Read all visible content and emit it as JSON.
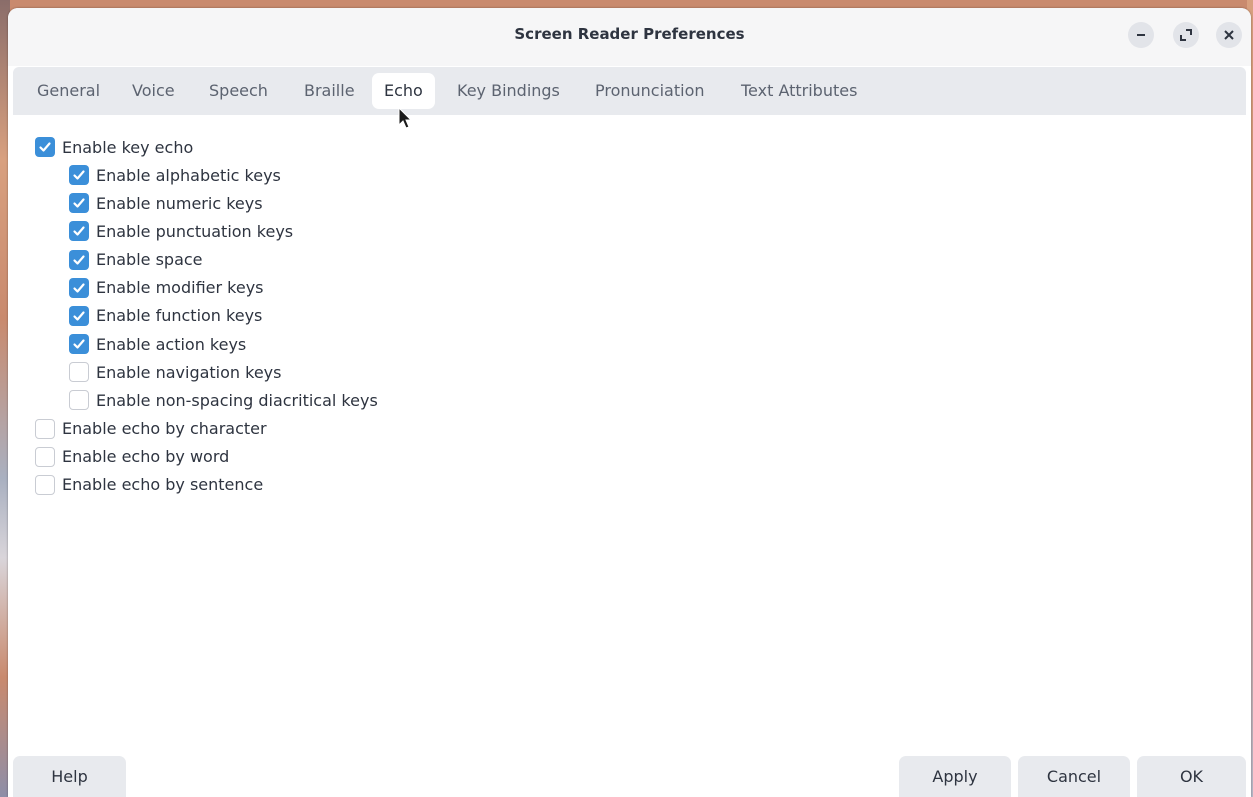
{
  "window": {
    "title": "Screen Reader Preferences"
  },
  "title_buttons": {
    "minimize": "minimize-icon",
    "maximize": "maximize-icon",
    "close": "close-icon"
  },
  "tabs": [
    {
      "label": "General"
    },
    {
      "label": "Voice"
    },
    {
      "label": "Speech"
    },
    {
      "label": "Braille"
    },
    {
      "label": "Echo",
      "active": true
    },
    {
      "label": "Key Bindings"
    },
    {
      "label": "Pronunciation"
    },
    {
      "label": "Text Attributes"
    }
  ],
  "options": [
    {
      "label": "Enable key echo",
      "checked": true,
      "indent": 0
    },
    {
      "label": "Enable alphabetic keys",
      "checked": true,
      "indent": 1
    },
    {
      "label": "Enable numeric keys",
      "checked": true,
      "indent": 1
    },
    {
      "label": "Enable punctuation keys",
      "checked": true,
      "indent": 1
    },
    {
      "label": "Enable space",
      "checked": true,
      "indent": 1
    },
    {
      "label": "Enable modifier keys",
      "checked": true,
      "indent": 1
    },
    {
      "label": "Enable function keys",
      "checked": true,
      "indent": 1
    },
    {
      "label": "Enable action keys",
      "checked": true,
      "indent": 1
    },
    {
      "label": "Enable navigation keys",
      "checked": false,
      "indent": 1
    },
    {
      "label": "Enable non-spacing diacritical keys",
      "checked": false,
      "indent": 1
    },
    {
      "label": "Enable echo by character",
      "checked": false,
      "indent": 0
    },
    {
      "label": "Enable echo by word",
      "checked": false,
      "indent": 0
    },
    {
      "label": "Enable echo by sentence",
      "checked": false,
      "indent": 0
    }
  ],
  "footer": {
    "help": "Help",
    "apply": "Apply",
    "cancel": "Cancel",
    "ok": "OK"
  },
  "colors": {
    "accent": "#3b8fd9",
    "tabbar": "#e8eaee"
  }
}
